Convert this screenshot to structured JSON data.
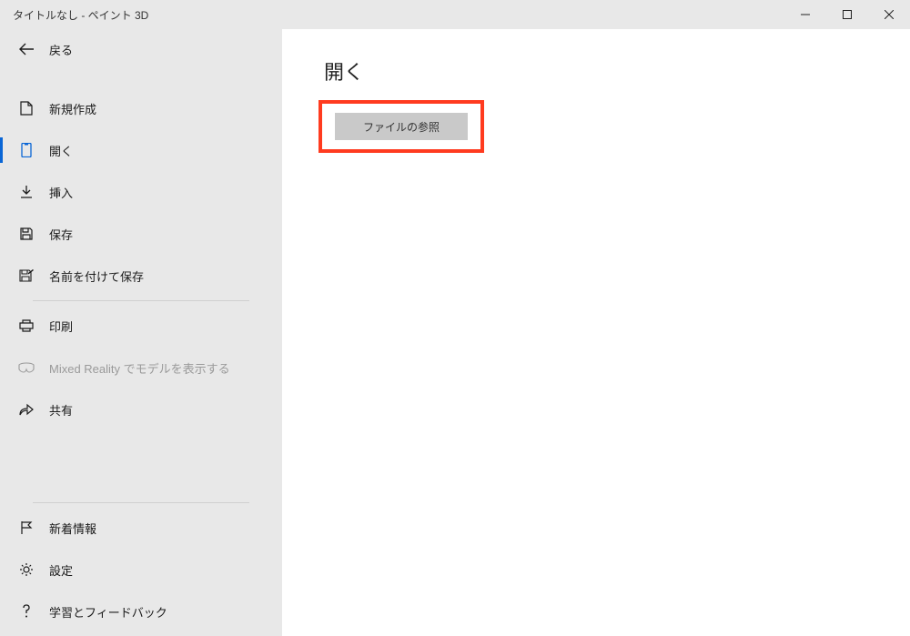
{
  "window": {
    "title": "タイトルなし - ペイント 3D"
  },
  "sidebar": {
    "back_label": "戻る",
    "items": [
      {
        "label": "新規作成"
      },
      {
        "label": "開く"
      },
      {
        "label": "挿入"
      },
      {
        "label": "保存"
      },
      {
        "label": "名前を付けて保存"
      },
      {
        "label": "印刷"
      },
      {
        "label": "Mixed Reality でモデルを表示する"
      },
      {
        "label": "共有"
      }
    ],
    "bottom_items": [
      {
        "label": "新着情報"
      },
      {
        "label": "設定"
      },
      {
        "label": "学習とフィードバック"
      }
    ]
  },
  "main": {
    "title": "開く",
    "browse_label": "ファイルの参照"
  }
}
